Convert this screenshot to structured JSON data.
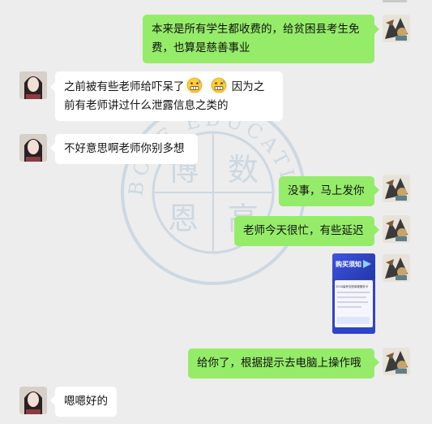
{
  "messages": [
    {
      "side": "right",
      "text": "本来是所有学生都收费的，给贫困县考生免费，也算是慈善事业"
    },
    {
      "side": "left",
      "text_before": "之前被有些老师给吓呆了",
      "text_after": "因为之前有老师讲过什么泄露信息之类的",
      "emoji": [
        "grimace-emoji",
        "grimace-emoji"
      ]
    },
    {
      "side": "left",
      "text": "不好意思啊老师你别多想"
    },
    {
      "side": "right",
      "text": "没事，马上发你"
    },
    {
      "side": "right",
      "text": "老师今天很忙，有些延迟"
    },
    {
      "side": "right",
      "type": "image",
      "title": "购买须知",
      "subtitle": "2018高考志愿填报服务卡"
    },
    {
      "side": "right",
      "text": "给你了，根据提示去电脑上操作哦"
    },
    {
      "side": "left",
      "text": "嗯嗯好的"
    }
  ],
  "watermark": {
    "ring_text": "BOLE EDUCATION",
    "glyphs": [
      "博",
      "数",
      "恩",
      "高"
    ]
  },
  "colors": {
    "background": "#ededed",
    "sent_bubble": "#95ec69",
    "received_bubble": "#ffffff",
    "watermark": "#7aa3c7"
  }
}
